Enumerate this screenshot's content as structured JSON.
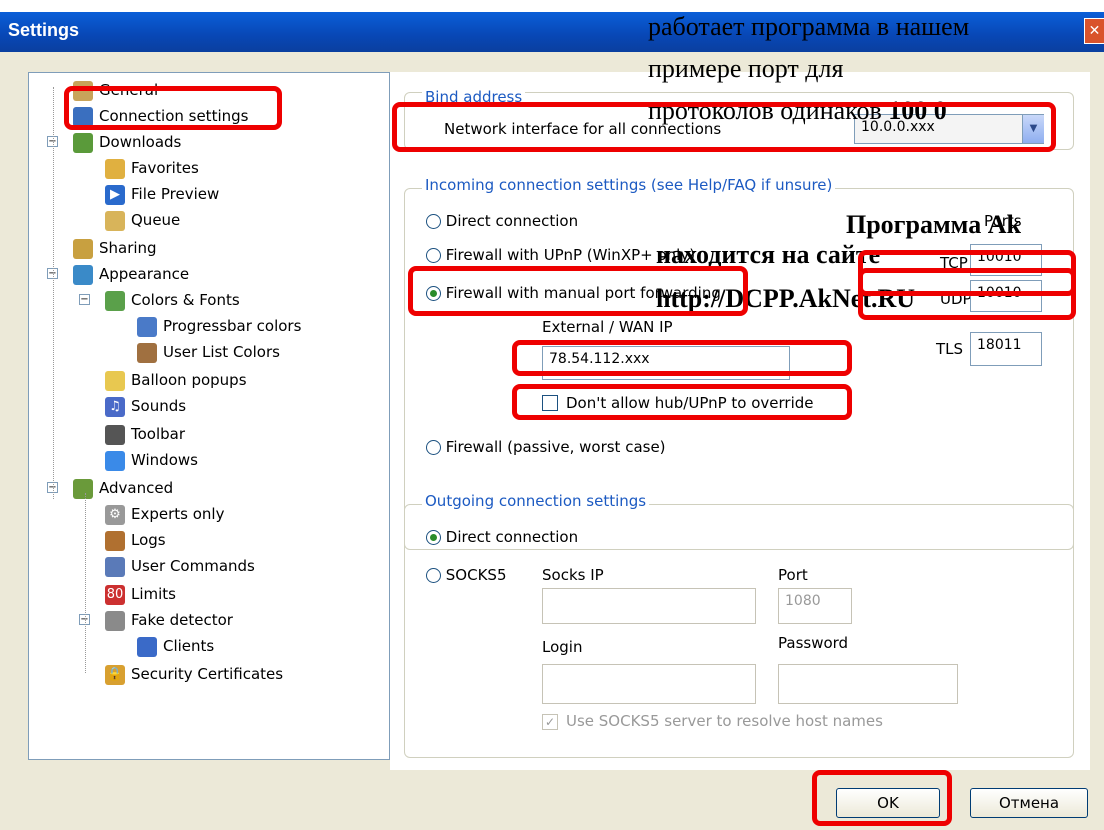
{
  "window": {
    "title": "Settings"
  },
  "tree": [
    {
      "label": "General",
      "icon": "general-icon",
      "level": 1
    },
    {
      "label": "Connection settings",
      "icon": "network-icon",
      "level": 1
    },
    {
      "label": "Downloads",
      "icon": "downloads-icon",
      "level": 1
    },
    {
      "label": "Favorites",
      "icon": "folder-icon",
      "level": 2
    },
    {
      "label": "File Preview",
      "icon": "play-icon",
      "level": 2
    },
    {
      "label": "Queue",
      "icon": "queue-icon",
      "level": 2
    },
    {
      "label": "Sharing",
      "icon": "sharing-icon",
      "level": 1
    },
    {
      "label": "Appearance",
      "icon": "appearance-icon",
      "level": 1
    },
    {
      "label": "Colors & Fonts",
      "icon": "colors-icon",
      "level": 2
    },
    {
      "label": "Progressbar colors",
      "icon": "progressbar-icon",
      "level": 3
    },
    {
      "label": "User List Colors",
      "icon": "user-icon",
      "level": 3
    },
    {
      "label": "Balloon popups",
      "icon": "balloon-icon",
      "level": 2
    },
    {
      "label": "Sounds",
      "icon": "note-icon",
      "level": 2
    },
    {
      "label": "Toolbar",
      "icon": "toolbar-icon",
      "level": 2
    },
    {
      "label": "Windows",
      "icon": "windows-icon",
      "level": 2
    },
    {
      "label": "Advanced",
      "icon": "advanced-icon",
      "level": 1
    },
    {
      "label": "Experts only",
      "icon": "gear-icon",
      "level": 2
    },
    {
      "label": "Logs",
      "icon": "logs-icon",
      "level": 2
    },
    {
      "label": "User Commands",
      "icon": "commands-icon",
      "level": 2
    },
    {
      "label": "Limits",
      "icon": "limit-icon",
      "level": 2
    },
    {
      "label": "Fake detector",
      "icon": "detector-icon",
      "level": 2
    },
    {
      "label": "Clients",
      "icon": "clients-icon",
      "level": 3
    },
    {
      "label": "Security Certificates",
      "icon": "lock-icon",
      "level": 2
    }
  ],
  "bind": {
    "group_label": "Bind address",
    "label": "Network interface for all connections",
    "value": "10.0.0.xxx"
  },
  "incoming": {
    "group_label": "Incoming connection settings (see Help/FAQ if unsure)",
    "direct": "Direct connection",
    "upnp": "Firewall with UPnP (WinXP+ only)",
    "manual": "Firewall with manual port forwarding",
    "external_label": "External / WAN IP",
    "external_value": "78.54.112.xxx",
    "no_override": "Don't allow hub/UPnP to override",
    "passive": "Firewall (passive, worst case)",
    "ports_label": "Ports",
    "tcp_label": "TCP",
    "tcp_value": "10010",
    "udp_label": "UDP",
    "udp_value": "10010",
    "tls_label": "TLS",
    "tls_value": "18011"
  },
  "outgoing": {
    "group_label": "Outgoing connection settings",
    "direct": "Direct connection",
    "socks5": "SOCKS5",
    "socks_ip_label": "Socks IP",
    "port_label": "Port",
    "port_value": "1080",
    "login_label": "Login",
    "password_label": "Password",
    "resolve": "Use SOCKS5 server to resolve host names"
  },
  "buttons": {
    "ok": "OK",
    "cancel": "Отмена"
  },
  "overlay": {
    "line1": "работает программа в нашем",
    "line2": "примере порт для",
    "line3a": "протоколов одинаков ",
    "line3b": "100 0",
    "line4": "Программа Ak",
    "line5": "находится на сайте",
    "line6": "http://DCPP.AkNet.RU"
  },
  "colors": {
    "highlight": "#ee0000",
    "titlebar": "#0a5fd8",
    "group_label": "#1c5ac2"
  }
}
